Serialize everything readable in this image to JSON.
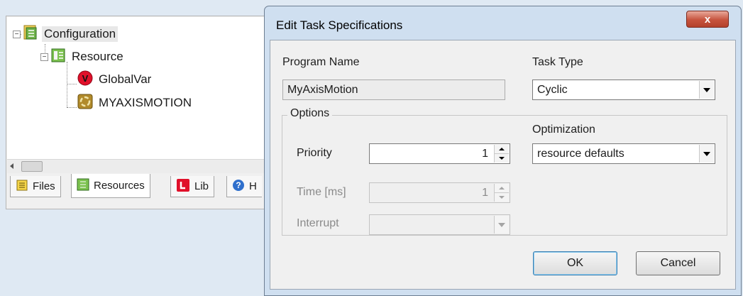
{
  "tree": {
    "nodes": [
      {
        "label": "Configuration",
        "icon": "configuration-icon",
        "expanded": true
      },
      {
        "label": "Resource",
        "icon": "resource-icon",
        "expanded": true
      },
      {
        "label": "GlobalVar",
        "icon": "global-variable-icon"
      },
      {
        "label": "MYAXISMOTION",
        "icon": "program-task-icon"
      }
    ],
    "expander_glyph": "−",
    "global_var_badge": "V"
  },
  "tabs": [
    {
      "label": "Files",
      "icon": "files-icon"
    },
    {
      "label": "Resources",
      "icon": "resources-icon",
      "active": true
    },
    {
      "label": "Lib",
      "icon": "library-icon"
    },
    {
      "label": "H",
      "icon": "help-icon"
    }
  ],
  "tab_help_glyph": "?",
  "dialog": {
    "title": "Edit Task Specifications",
    "close_glyph": "x",
    "program_name_label": "Program Name",
    "program_name_value": "MyAxisMotion",
    "task_type_label": "Task Type",
    "task_type_value": "Cyclic",
    "options_group_label": "Options",
    "priority_label": "Priority",
    "priority_value": "1",
    "time_label": "Time [ms]",
    "time_value": "1",
    "interrupt_label": "Interrupt",
    "interrupt_value": "",
    "optimization_label": "Optimization",
    "optimization_value": "resource defaults",
    "ok_label": "OK",
    "cancel_label": "Cancel"
  },
  "colors": {
    "desktop": "#dfe9f3",
    "dialog_frame": "#cfdff0",
    "close_button": "#c6533d",
    "global_var_icon": "#e0102a",
    "resource_icon": "#5a9e3a"
  }
}
